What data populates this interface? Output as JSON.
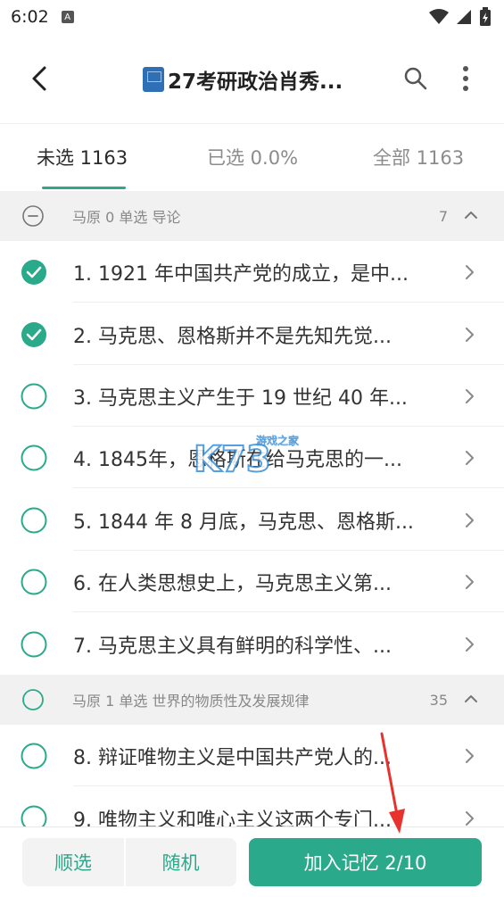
{
  "status_bar": {
    "time": "6:02",
    "notification_icon": "A"
  },
  "header": {
    "title": "27考研政治肖秀...",
    "book_icon": "blue-book-icon"
  },
  "tabs": [
    {
      "label": "未选 1163",
      "active": true
    },
    {
      "label": "已选 0.0%",
      "active": false
    },
    {
      "label": "全部 1163",
      "active": false
    }
  ],
  "groups": [
    {
      "label": "马原 0 单选 导论",
      "count": "7",
      "state": "partial"
    },
    {
      "label": "马原 1 单选 世界的物质性及发展规律",
      "count": "35",
      "state": "unchecked"
    }
  ],
  "items": [
    {
      "text": "1. 1921 年中国共产党的成立，是中...",
      "checked": true
    },
    {
      "text": "2. 马克思、恩格斯并不是先知先觉...",
      "checked": true
    },
    {
      "text": "3. 马克思主义产生于 19 世纪 40 年...",
      "checked": false
    },
    {
      "text": "4. 1845年，恩格斯在给马克思的一...",
      "checked": false
    },
    {
      "text": "5. 1844 年 8 月底，马克思、恩格斯...",
      "checked": false
    },
    {
      "text": "6. 在人类思想史上，马克思主义第...",
      "checked": false
    },
    {
      "text": "7. 马克思主义具有鲜明的科学性、...",
      "checked": false
    },
    {
      "text": "8. 辩证唯物主义是中国共产党人的...",
      "checked": false
    },
    {
      "text": "9. 唯物主义和唯心主义这两个专门...",
      "checked": false
    }
  ],
  "bottom": {
    "sequential_label": "顺选",
    "random_label": "随机",
    "add_label": "加入记忆 2/10"
  },
  "watermark": {
    "text": "K73",
    "subtext": "游戏之家"
  },
  "colors": {
    "accent": "#2aa98b",
    "group_bg": "#f1f1f1"
  }
}
